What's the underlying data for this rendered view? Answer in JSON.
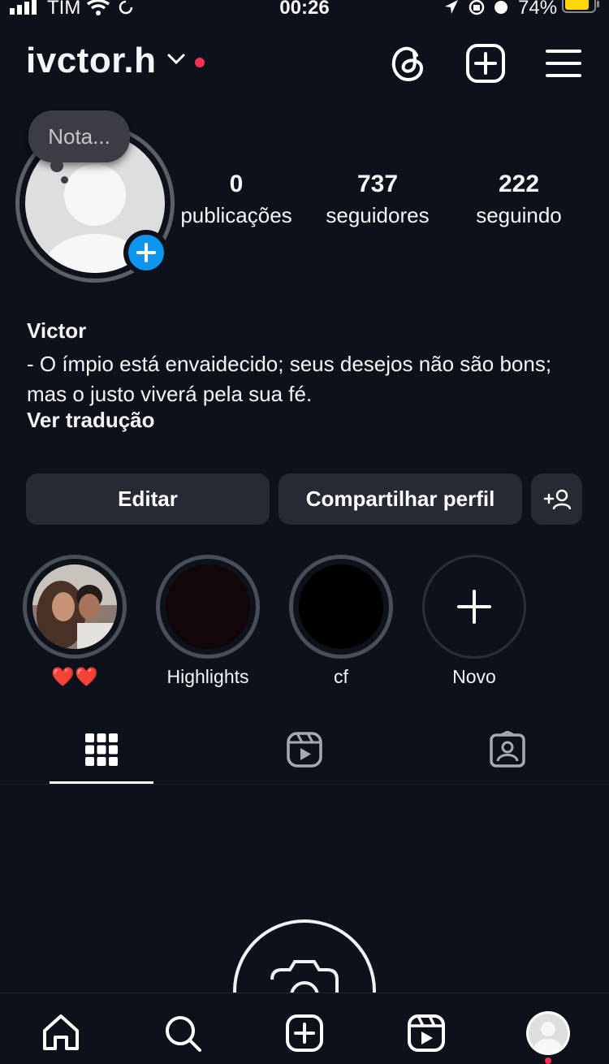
{
  "status_bar": {
    "carrier": "TIM",
    "time": "00:26",
    "battery": "74%"
  },
  "header": {
    "username": "ivctor.h",
    "icons": [
      "threads-icon",
      "new-post-icon",
      "menu-icon"
    ]
  },
  "profile": {
    "note_placeholder": "Nota...",
    "stats": [
      {
        "value": "0",
        "label": "publicações"
      },
      {
        "value": "737",
        "label": "seguidores"
      },
      {
        "value": "222",
        "label": "seguindo"
      }
    ],
    "name": "Victor",
    "bio": "- O ímpio está envaidecido; seus desejos não são bons; mas o justo viverá pela sua fé.",
    "translate_link": "Ver tradução"
  },
  "actions": {
    "edit": "Editar",
    "share": "Compartilhar perfil"
  },
  "highlights": [
    {
      "label": "❤️❤️"
    },
    {
      "label": "Highlights"
    },
    {
      "label": "cf"
    },
    {
      "label": "Novo"
    }
  ],
  "tabs": [
    "grid-icon",
    "reels-icon",
    "tagged-icon"
  ],
  "bottom_nav": [
    "home-icon",
    "search-icon",
    "create-icon",
    "reels-icon",
    "profile-avatar"
  ],
  "colors": {
    "background": "#0c111a",
    "accent_blue": "#0d95f0",
    "notification_red": "#ff2d55",
    "button_bg": "#262a32"
  }
}
